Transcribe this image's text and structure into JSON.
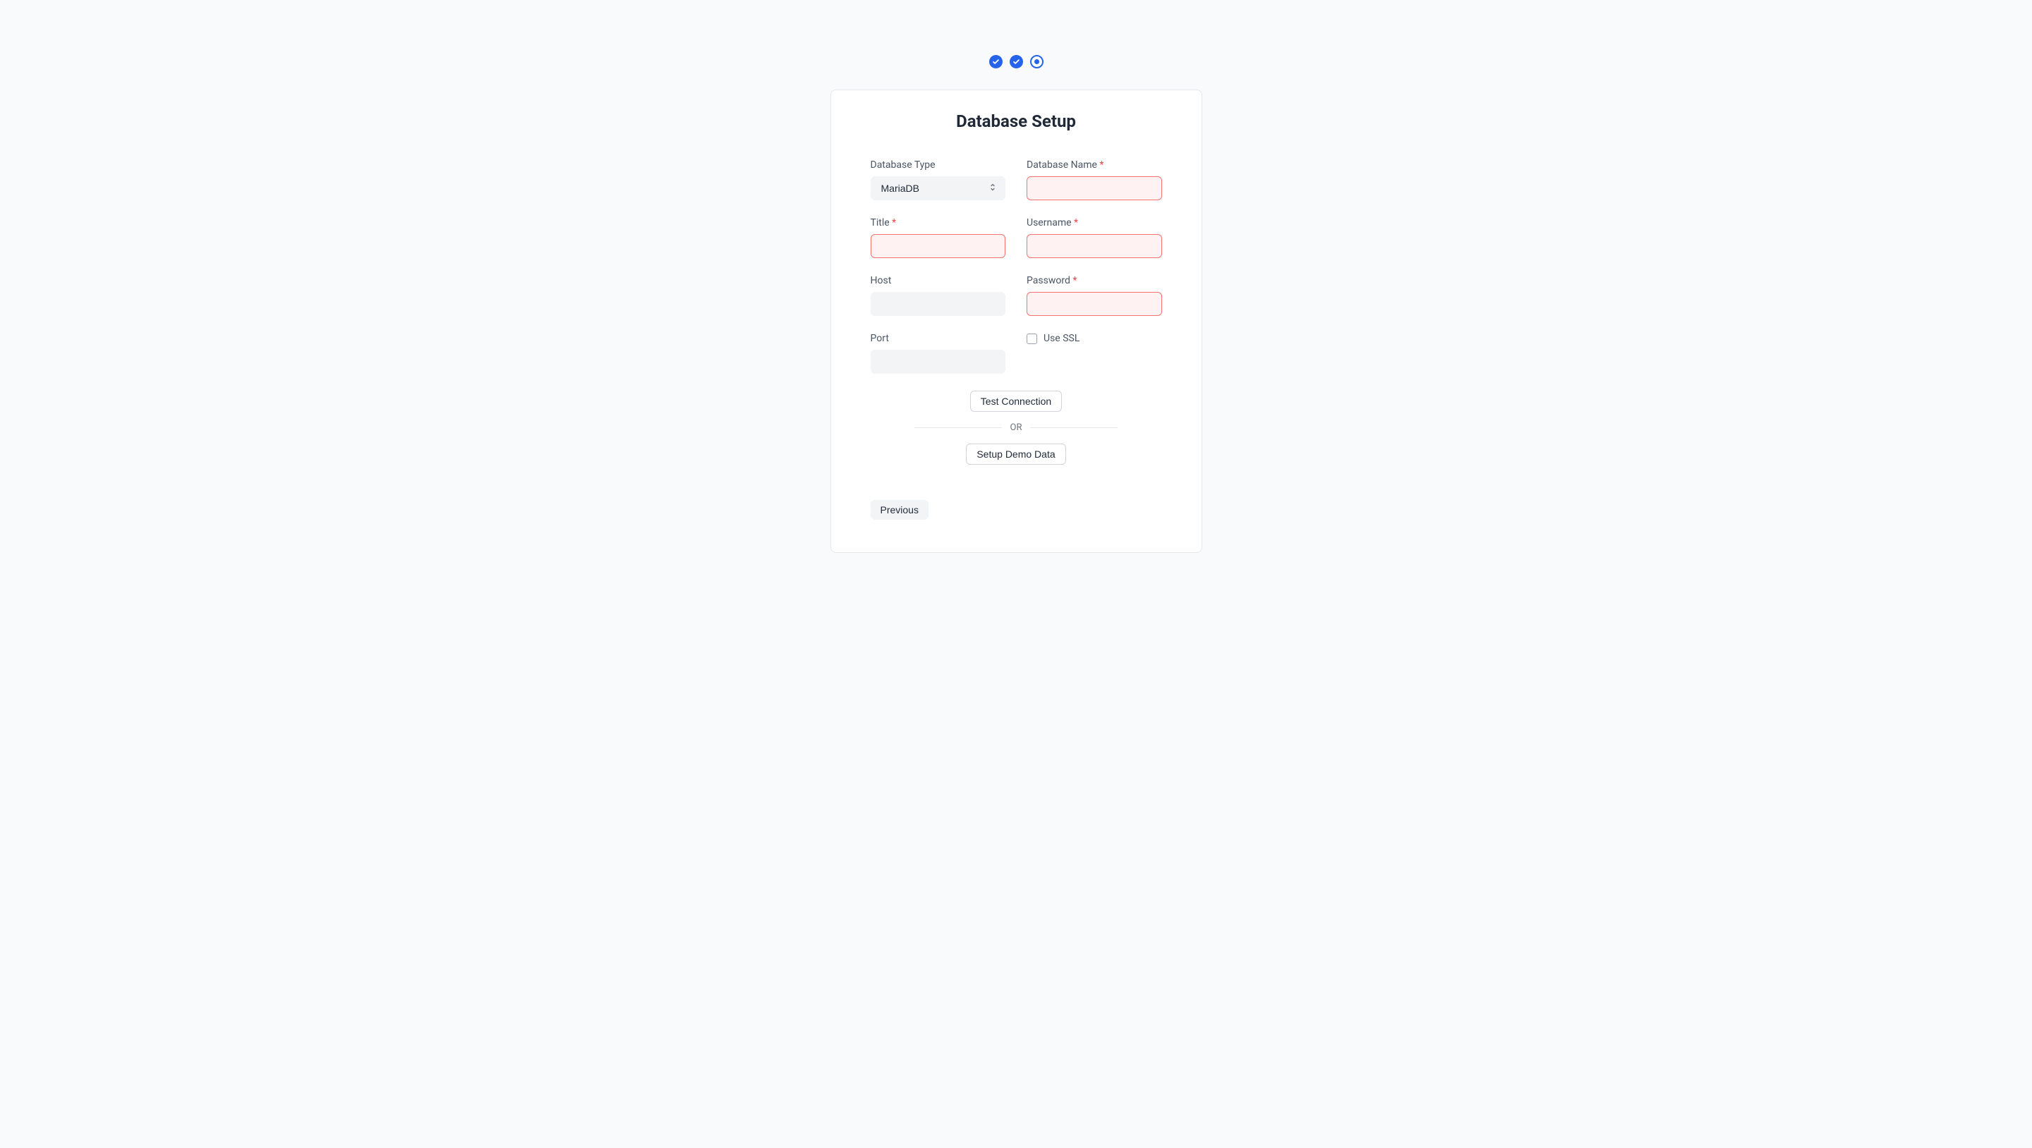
{
  "title": "Database Setup",
  "fields": {
    "db_type": {
      "label": "Database Type",
      "value": "MariaDB"
    },
    "db_name": {
      "label": "Database Name"
    },
    "title": {
      "label": "Title"
    },
    "username": {
      "label": "Username"
    },
    "host": {
      "label": "Host"
    },
    "password": {
      "label": "Password"
    },
    "port": {
      "label": "Port"
    },
    "ssl": {
      "label": "Use SSL"
    }
  },
  "buttons": {
    "test": "Test Connection",
    "or": "OR",
    "demo": "Setup Demo Data",
    "previous": "Previous"
  },
  "required_mark": "*"
}
